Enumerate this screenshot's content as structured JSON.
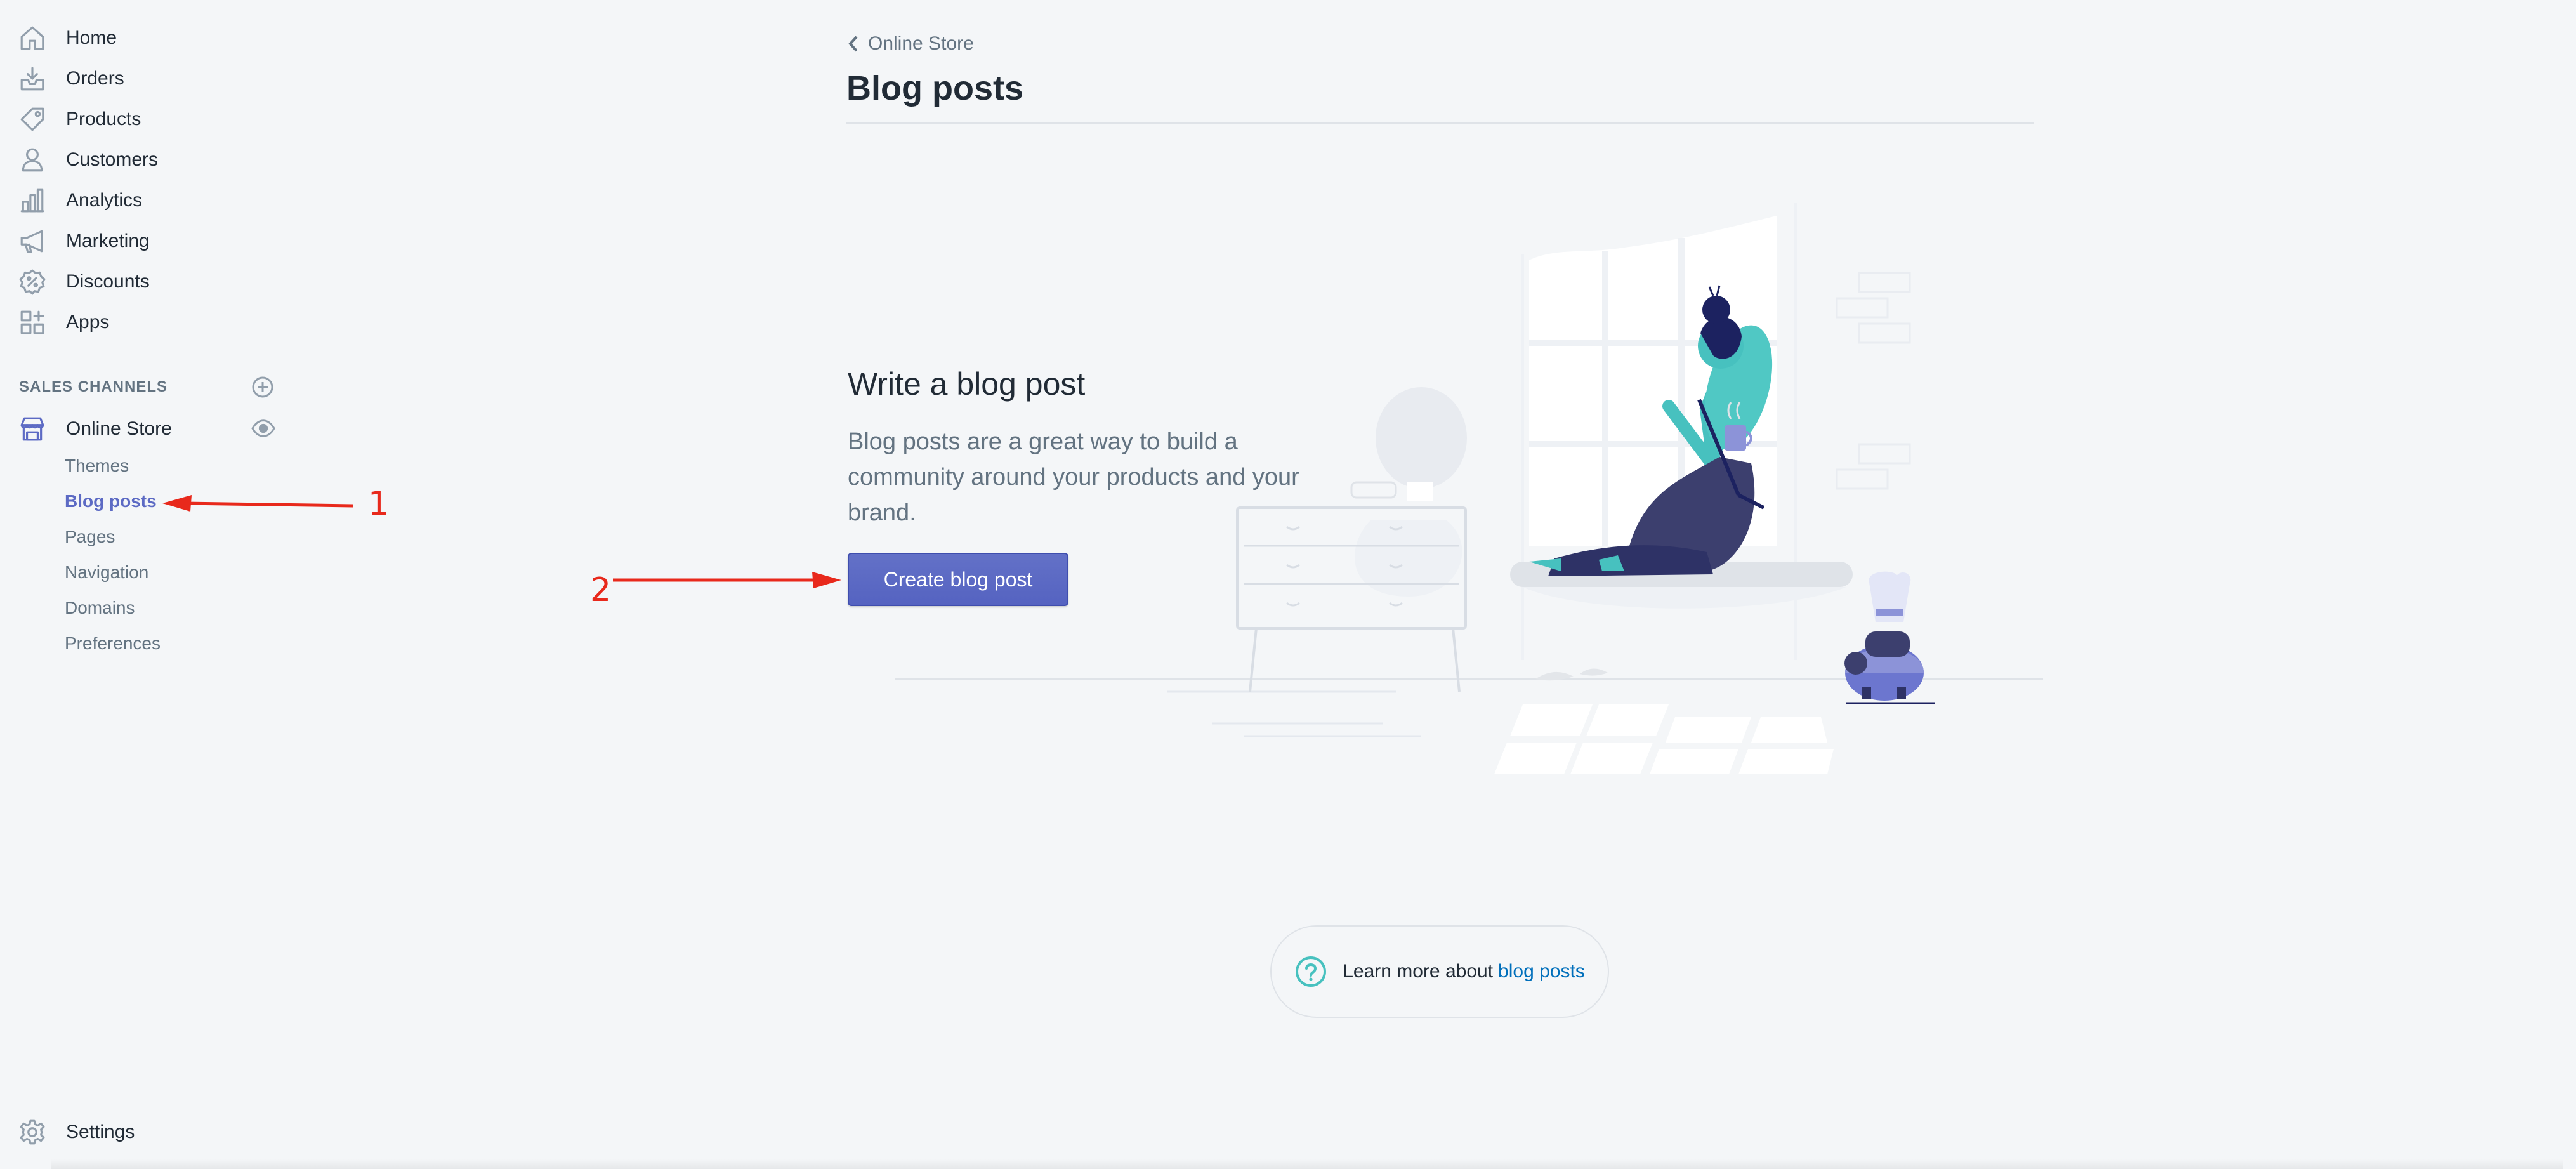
{
  "nav": {
    "items": [
      {
        "label": "Home",
        "icon": "home-icon"
      },
      {
        "label": "Orders",
        "icon": "orders-icon"
      },
      {
        "label": "Products",
        "icon": "tag-icon"
      },
      {
        "label": "Customers",
        "icon": "person-icon"
      },
      {
        "label": "Analytics",
        "icon": "bar-chart-icon"
      },
      {
        "label": "Marketing",
        "icon": "megaphone-icon"
      },
      {
        "label": "Discounts",
        "icon": "discount-icon"
      },
      {
        "label": "Apps",
        "icon": "apps-icon"
      }
    ],
    "sales_channels_title": "SALES CHANNELS",
    "online_store": "Online Store",
    "sub_items": [
      "Themes",
      "Blog posts",
      "Pages",
      "Navigation",
      "Domains",
      "Preferences"
    ],
    "settings": "Settings"
  },
  "annotations": {
    "arrow1_label": "1",
    "arrow2_label": "2",
    "color": "#e8291c"
  },
  "main": {
    "breadcrumb": "Online Store",
    "title": "Blog posts",
    "empty_state": {
      "heading": "Write a blog post",
      "description": "Blog posts are a great way to build a community around your products and your brand.",
      "button": "Create blog post"
    },
    "footer": {
      "text": "Learn more about",
      "link": "blog posts"
    }
  },
  "colors": {
    "accent": "#5c6ac4",
    "background": "#f4f6f8",
    "link": "#006fbb",
    "teal": "#47c1bf"
  }
}
